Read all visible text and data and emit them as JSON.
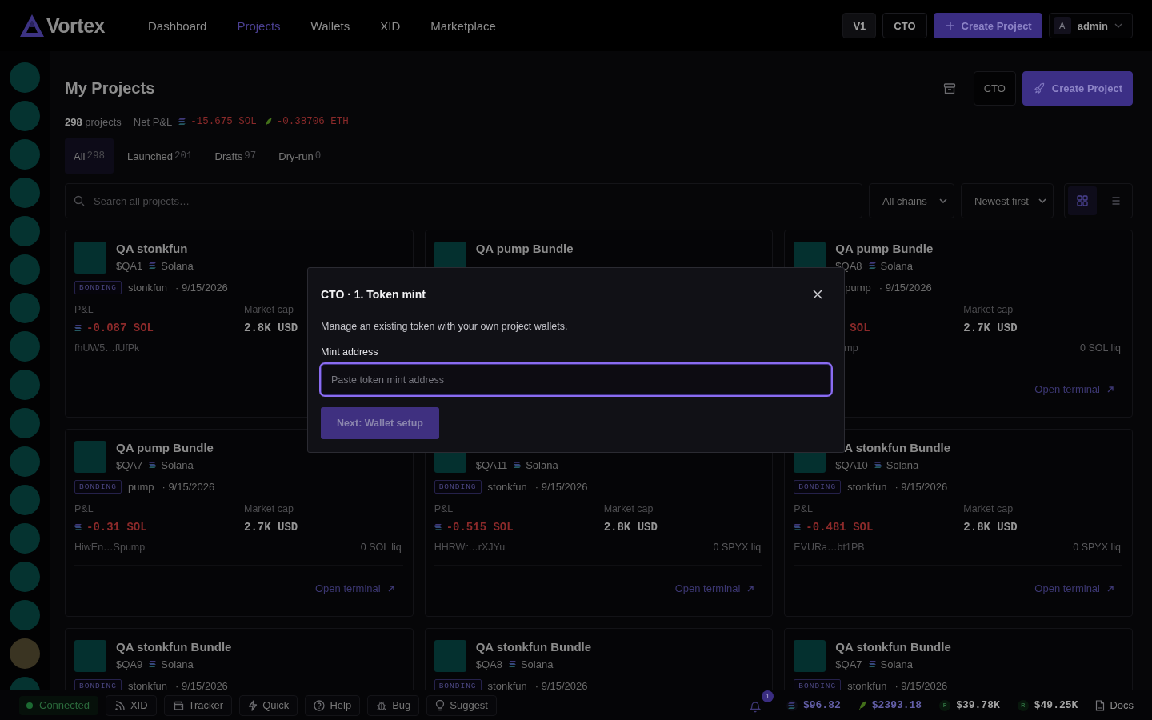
{
  "nav": {
    "logo": "Vortex",
    "items": [
      {
        "label": "Dashboard",
        "selected": false
      },
      {
        "label": "Projects",
        "selected": true
      },
      {
        "label": "Wallets",
        "selected": false
      },
      {
        "label": "XID",
        "selected": false
      },
      {
        "label": "Marketplace",
        "selected": false
      }
    ],
    "version_button": "V1",
    "cto_button": "CTO",
    "create_button": "Create Project",
    "user": {
      "initial": "A",
      "name": "admin"
    }
  },
  "sidebar": {
    "items": [
      {
        "kind": "project"
      },
      {
        "kind": "project"
      },
      {
        "kind": "project"
      },
      {
        "kind": "project"
      },
      {
        "kind": "project"
      },
      {
        "kind": "project"
      },
      {
        "kind": "project"
      },
      {
        "kind": "project"
      },
      {
        "kind": "project"
      },
      {
        "kind": "project"
      },
      {
        "kind": "project"
      },
      {
        "kind": "project"
      },
      {
        "kind": "project"
      },
      {
        "kind": "project"
      },
      {
        "kind": "project"
      },
      {
        "kind": "photo"
      },
      {
        "kind": "project"
      }
    ]
  },
  "header": {
    "title": "My Projects",
    "cto_button": "CTO",
    "create_button": "Create Project"
  },
  "summary": {
    "count": "**298** projects",
    "net_label": "Net P&L",
    "values": [
      "-15.675 SOL",
      "-0.38706 ETH"
    ]
  },
  "tabs": [
    {
      "label": "All",
      "count": "298",
      "selected": true
    },
    {
      "label": "Launched",
      "count": "201",
      "selected": false
    },
    {
      "label": "Drafts",
      "count": "97",
      "selected": false
    },
    {
      "label": "Dry-run",
      "count": "0",
      "selected": false
    }
  ],
  "filters": {
    "search_placeholder": "Search all projects…",
    "chain": "All chains",
    "sort": "Newest first",
    "views": [
      {
        "selected": true
      },
      {
        "selected": false
      }
    ]
  },
  "cards": [
    {
      "title": "QA stonkfun",
      "ticker": "$QA1",
      "chain": "Solana",
      "status": "BONDING",
      "platform": "stonkfun",
      "date": "· 9/15/2026",
      "pnl_label": "P&L",
      "pnl": "-0.087 SOL",
      "cap_label": "Market cap",
      "cap": "2.8K USD",
      "address": "fhUW5…fUfPk"
    },
    {
      "title": "QA pump Bundle"
    },
    {
      "title": "QA pump Bundle",
      "ticker": "$QA8",
      "chain": "Solana",
      "platform": "pump",
      "date": "· 9/15/2026",
      "pnl": "SOL",
      "cap_label": "Market cap",
      "cap": "2.7K USD",
      "address": "mp",
      "liquidity": "0 SOL liq",
      "link": "Open terminal"
    },
    {
      "title": "QA pump Bundle",
      "ticker": "$QA7",
      "chain": "Solana",
      "status": "BONDING",
      "platform": "pump",
      "date": "· 9/15/2026",
      "pnl_label": "P&L",
      "pnl": "-0.31 SOL",
      "cap_label": "Market cap",
      "cap": "2.7K USD",
      "address": "HiwEn…Spump",
      "liquidity": "0 SOL liq",
      "link": "Open terminal"
    },
    {
      "ticker": "$QA11",
      "chain": "Solana",
      "status": "BONDING",
      "platform": "stonkfun",
      "date": "· 9/15/2026",
      "pnl_label": "P&L",
      "pnl": "-0.515 SOL",
      "cap_label": "Market cap",
      "cap": "2.8K USD",
      "address": "HHRWr…rXJYu",
      "liquidity": "0 SPYX liq",
      "link": "Open terminal"
    },
    {
      "title": "A stonkfun Bundle",
      "ticker": "$QA10",
      "chain": "Solana",
      "status": "BONDING",
      "platform": "stonkfun",
      "date": "· 9/15/2026",
      "pnl_label": "P&L",
      "pnl": "-0.481 SOL",
      "cap_label": "Market cap",
      "cap": "2.8K USD",
      "address": "EVURa…bt1PB",
      "liquidity": "0 SPYX liq",
      "link": "Open terminal"
    },
    {
      "title": "QA stonkfun Bundle",
      "ticker": "$QA9",
      "chain": "Solana",
      "status": "BONDING",
      "platform": "stonkfun",
      "date": "· 9/15/2026"
    },
    {
      "title": "QA stonkfun Bundle",
      "ticker": "$QA8",
      "chain": "Solana",
      "status": "BONDING",
      "platform": "stonkfun",
      "date": "· 9/15/2026"
    },
    {
      "title": "QA stonkfun Bundle",
      "ticker": "$QA7",
      "chain": "Solana",
      "status": "BONDING",
      "platform": "stonkfun",
      "date": "· 9/15/2026"
    }
  ],
  "dialog": {
    "title": "CTO · 1. Token mint",
    "description": "Manage an existing token with your own project wallets.",
    "field_label": "Mint address",
    "placeholder": "Paste token mint address",
    "focused": true,
    "button": "Next: Wallet setup",
    "button_disabled": true
  },
  "footer": {
    "status": {
      "label": "Connected",
      "connected": true
    },
    "tools": [
      {
        "label": "XID"
      },
      {
        "label": "Tracker"
      },
      {
        "label": "Quick"
      },
      {
        "label": "Help"
      },
      {
        "label": "Bug"
      },
      {
        "label": "Suggest"
      }
    ],
    "notifications": "1",
    "prices": [
      {
        "value": "$96.82",
        "color": "#625ea6"
      },
      {
        "value": "$2393.18",
        "color": "#625ea6"
      },
      {
        "symbol": "P",
        "value": "$39.78K",
        "color": "#a3a3a3"
      },
      {
        "symbol": "R",
        "value": "$49.25K",
        "color": "#a3a3a3"
      }
    ],
    "docs": "Docs"
  }
}
